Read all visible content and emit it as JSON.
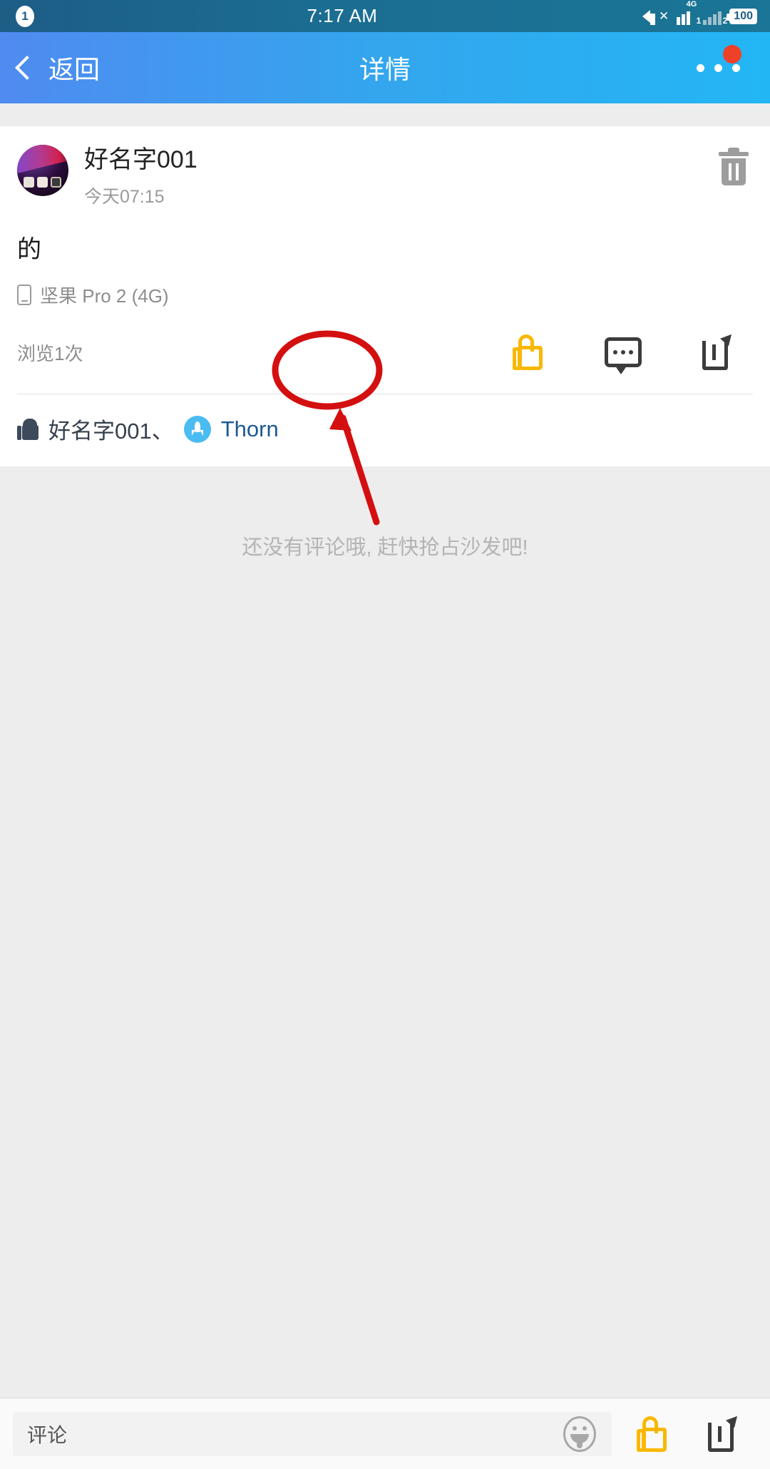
{
  "statusbar": {
    "notification_count": "1",
    "time": "7:17 AM",
    "mute_icon": "speaker-mute-icon",
    "sim1_network": "4G",
    "sim1_label": "1",
    "sim2_label": "2",
    "battery": "100"
  },
  "navbar": {
    "back_label": "返回",
    "title": "详情",
    "more_icon": "more-dots-icon",
    "badge_color": "#ef4128",
    "gradient_from": "#4f8bf0",
    "gradient_to": "#23b6f5"
  },
  "post": {
    "author": "好名字001",
    "timestamp": "今天07:15",
    "content": "的",
    "device": "坚果 Pro 2 (4G)",
    "views": "浏览1次",
    "delete_icon": "trash-icon",
    "like_icon": "thumbs-up-icon",
    "comment_icon": "comment-bubble-icon",
    "share_icon": "share-icon",
    "like_color": "#f9b800"
  },
  "likers": {
    "icon": "thumbs-up-solid-icon",
    "first": "好名字001、",
    "second": "Thorn",
    "second_avatar": "rocket-avatar-icon",
    "avatar_color": "#4bbcf2",
    "link_color": "#1d5a96"
  },
  "comments": {
    "empty_message": "还没有评论哦, 赶快抢占沙发吧!"
  },
  "bottombar": {
    "comment_placeholder": "评论",
    "emoji_icon": "emoji-face-icon",
    "like_icon": "thumbs-up-icon",
    "share_icon": "share-icon"
  },
  "annotation": {
    "ellipse_color": "#d40f0f",
    "arrow_color": "#d40f0f"
  }
}
